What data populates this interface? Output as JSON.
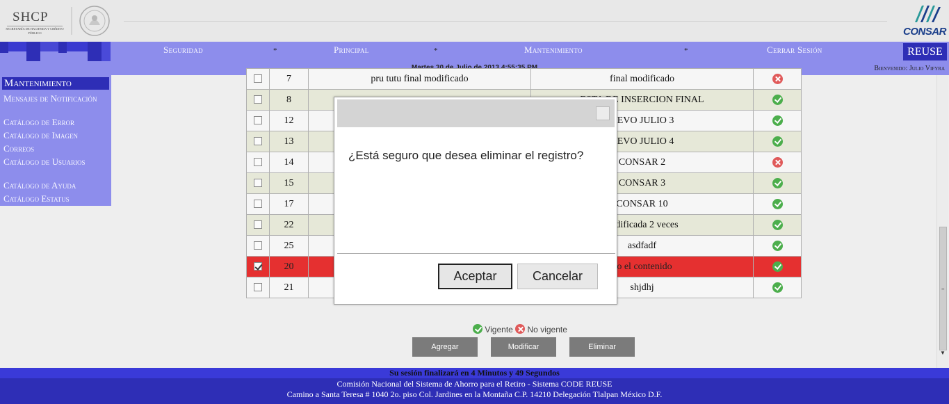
{
  "header": {
    "shcp_text": "SHCP",
    "shcp_subtext": "SECRETARÍA DE HACIENDA Y CRÉDITO PÚBLICO",
    "consar_logo_text": "CONSAR"
  },
  "nav": {
    "items": [
      "Seguridad",
      "Principal",
      "Mantenimiento",
      "Cerrar Sesión"
    ],
    "separator": "*",
    "datetime": "Martes 30 de Julio de 2013 4:55:35 PM",
    "welcome": "Bienvenido: Julio Vifyra",
    "badge": "REUSE"
  },
  "sidebar": {
    "title": "Mantenimiento",
    "items": [
      "Mensajes de Notificación",
      "Catálogo de Error",
      "Catálogo de Imagen",
      "Correos",
      "Catálogo de Usuarios",
      "Catálogo de Ayuda",
      "Catálogo Estatus"
    ]
  },
  "table": {
    "rows": [
      {
        "id": "7",
        "col_a": "pru tutu final modificado",
        "col_b": "final modificado",
        "status": "no",
        "checked": false
      },
      {
        "id": "8",
        "col_a": "",
        "col_b": "ESTA DE INSERCION FINAL",
        "status": "ok",
        "checked": false
      },
      {
        "id": "12",
        "col_a": "",
        "col_b": "VEVO JULIO 3",
        "status": "ok",
        "checked": false
      },
      {
        "id": "13",
        "col_a": "",
        "col_b": "VEVO JULIO 4",
        "status": "ok",
        "checked": false
      },
      {
        "id": "14",
        "col_a": "",
        "col_b": "CONSAR 2",
        "status": "no",
        "checked": false
      },
      {
        "id": "15",
        "col_a": "",
        "col_b": "CONSAR 3",
        "status": "ok",
        "checked": false
      },
      {
        "id": "17",
        "col_a": "",
        "col_b": "CONSAR 10",
        "status": "ok",
        "checked": false
      },
      {
        "id": "22",
        "col_a": "",
        "col_b": "nodificada 2 veces",
        "status": "ok",
        "checked": false
      },
      {
        "id": "25",
        "col_a": "",
        "col_b": "asdfadf",
        "status": "ok",
        "checked": false
      },
      {
        "id": "20",
        "col_a": "",
        "col_b": "do el contenido",
        "status": "ok",
        "checked": true
      },
      {
        "id": "21",
        "col_a": "",
        "col_b": "shjdhj",
        "status": "ok",
        "checked": false
      }
    ]
  },
  "modal": {
    "message": "¿Está seguro que desea eliminar el registro?",
    "accept_label": "Aceptar",
    "cancel_label": "Cancelar"
  },
  "legend": {
    "valid_label": "Vigente",
    "invalid_label": "No vigente"
  },
  "actions": {
    "add_label": "Agregar",
    "modify_label": "Modificar",
    "delete_label": "Eliminar"
  },
  "footer": {
    "session_text": "Su sesión finalizará en 4 Minutos y 49 Segundos",
    "line1": "Comisión Nacional del Sistema de Ahorro para el Retiro - Sistema CODE REUSE",
    "line2": "Camino a Santa Teresa # 1040 2o. piso Col. Jardines en la Montaña C.P. 14210 Delegación Tlalpan México D.F."
  },
  "colors": {
    "nav_bg": "#8d8dec",
    "accent": "#2e2eb6",
    "selected_row": "#e53030",
    "status_ok": "#4cae4c",
    "status_no": "#e05a5a"
  }
}
